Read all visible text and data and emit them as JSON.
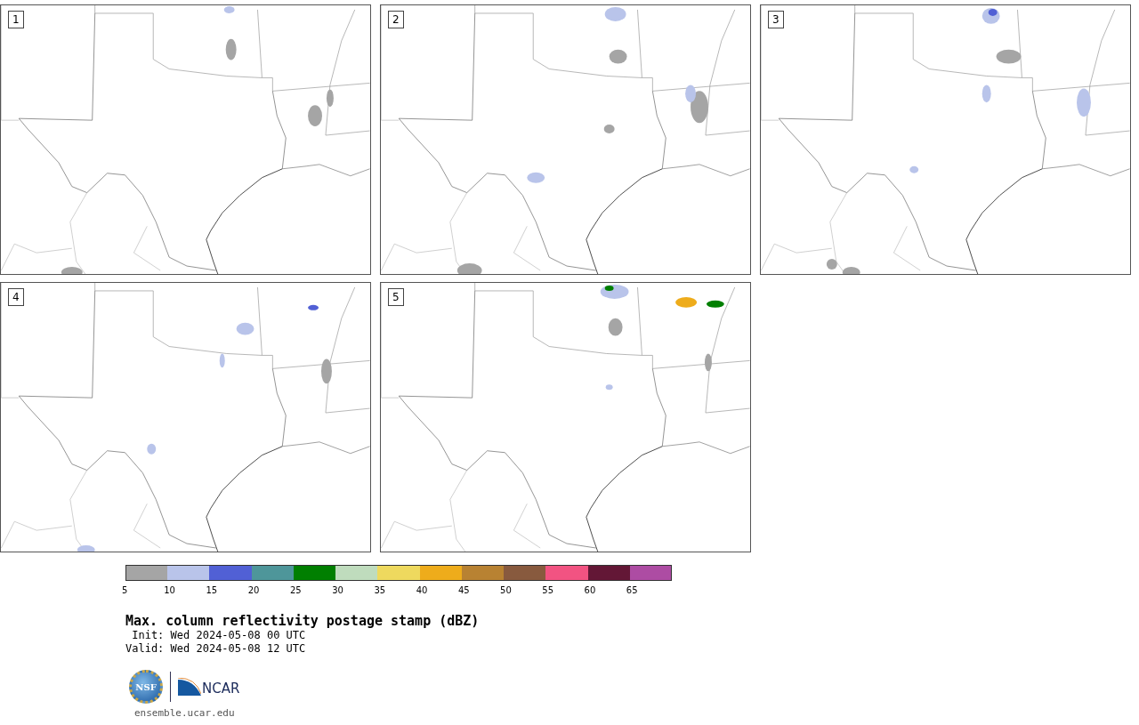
{
  "panels": [
    {
      "number": "1"
    },
    {
      "number": "2"
    },
    {
      "number": "3"
    },
    {
      "number": "4"
    },
    {
      "number": "5"
    }
  ],
  "colorbar": [
    {
      "label": "5",
      "color": "#a5a5a5"
    },
    {
      "label": "10",
      "color": "#b9c4ea"
    },
    {
      "label": "15",
      "color": "#5160d5"
    },
    {
      "label": "20",
      "color": "#4e969a"
    },
    {
      "label": "25",
      "color": "#017f01"
    },
    {
      "label": "30",
      "color": "#bfdcbd"
    },
    {
      "label": "35",
      "color": "#eed95e"
    },
    {
      "label": "40",
      "color": "#eeac1b"
    },
    {
      "label": "45",
      "color": "#b88232"
    },
    {
      "label": "50",
      "color": "#885a3e"
    },
    {
      "label": "55",
      "color": "#f25382"
    },
    {
      "label": "60",
      "color": "#631736"
    },
    {
      "label": "65",
      "color": "#ad4ca3"
    }
  ],
  "title": "Max. column reflectivity postage stamp (dBZ)",
  "init": " Init: Wed 2024-05-08 00 UTC",
  "valid": "Valid: Wed 2024-05-08 12 UTC",
  "logos": {
    "nsf": "NSF",
    "ncar": "NCAR"
  },
  "url": "ensemble.ucar.edu"
}
